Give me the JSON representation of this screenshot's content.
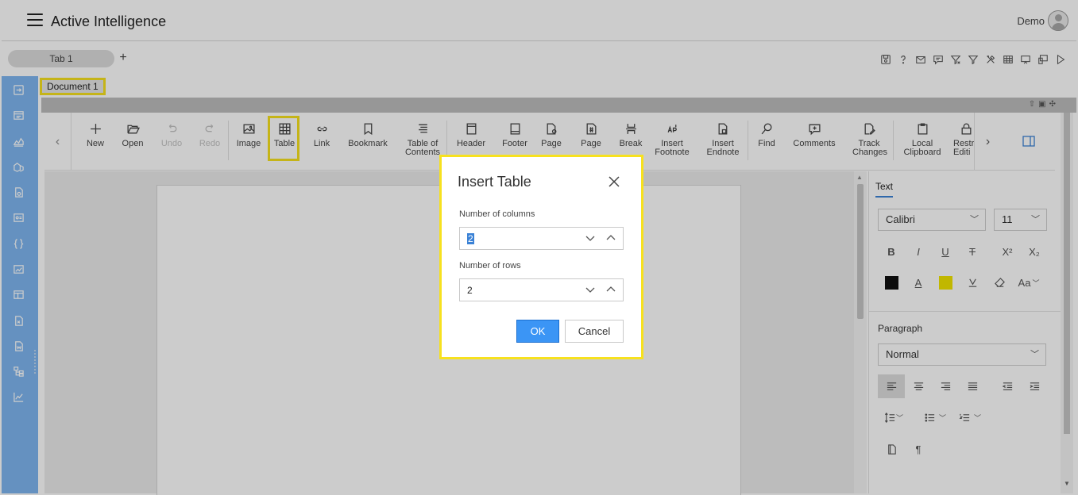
{
  "app": {
    "title": "Active Intelligence",
    "user_name": "Demo"
  },
  "tabs": [
    {
      "label": "Tab 1"
    }
  ],
  "tab_add_label": "+",
  "document": {
    "tab_label": "Document 1"
  },
  "ribbon": {
    "buttons": [
      {
        "label": "New"
      },
      {
        "label": "Open"
      },
      {
        "label": "Undo"
      },
      {
        "label": "Redo"
      },
      {
        "label": "Image"
      },
      {
        "label": "Table"
      },
      {
        "label": "Link"
      },
      {
        "label": "Bookmark"
      },
      {
        "label_line1": "Table of",
        "label_line2": "Contents"
      },
      {
        "label": "Header"
      },
      {
        "label": "Footer"
      },
      {
        "label": "Page"
      },
      {
        "label": "Page"
      },
      {
        "label": "Break"
      },
      {
        "label_line1": "Insert",
        "label_line2": "Footnote"
      },
      {
        "label_line1": "Insert",
        "label_line2": "Endnote"
      },
      {
        "label": "Find"
      },
      {
        "label": "Comments"
      },
      {
        "label_line1": "Track",
        "label_line2": "Changes"
      },
      {
        "label_line1": "Local",
        "label_line2": "Clipboard"
      },
      {
        "label_line1": "Restr",
        "label_line2": "Editi"
      }
    ]
  },
  "properties": {
    "tab_label": "Text",
    "font_family": "Calibri",
    "font_size": "11",
    "format_buttons": [
      "B",
      "I",
      "U",
      "T",
      "X²",
      "X₂"
    ],
    "case_label": "Aa",
    "paragraph_label": "Paragraph",
    "paragraph_style": "Normal",
    "pilcrow": "¶"
  },
  "dialog": {
    "title": "Insert Table",
    "columns_label": "Number of columns",
    "columns_value": "2",
    "rows_label": "Number of rows",
    "rows_value": "2",
    "ok_label": "OK",
    "cancel_label": "Cancel"
  },
  "colors": {
    "sidebar": "#7fb6f0",
    "highlight": "#f7e11e",
    "primary": "#3b95f5",
    "font_color_swatch": "#111111",
    "highlight_swatch": "#f2e500"
  }
}
